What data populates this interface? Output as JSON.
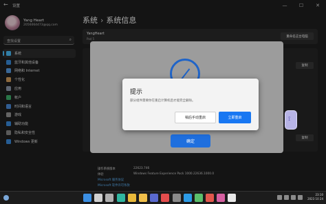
{
  "window": {
    "title": "设置",
    "back_glyph": "←",
    "minimize": "—",
    "maximize": "☐",
    "close": "✕"
  },
  "user": {
    "name": "Yang Heart",
    "email": "2056064473@qq.com"
  },
  "search": {
    "placeholder": "查找设置",
    "icon": "search-icon"
  },
  "sidebar": {
    "items": [
      {
        "label": "系统",
        "icon": "monitor-icon",
        "color": "#4cc2ff",
        "active": true
      },
      {
        "label": "蓝牙和其他设备",
        "icon": "bluetooth-icon",
        "color": "#3a8fe0"
      },
      {
        "label": "网络和 Internet",
        "icon": "wifi-icon",
        "color": "#5aa0e8"
      },
      {
        "label": "个性化",
        "icon": "brush-icon",
        "color": "#d9a25f"
      },
      {
        "label": "应用",
        "icon": "apps-icon",
        "color": "#8f9bb0"
      },
      {
        "label": "帐户",
        "icon": "account-icon",
        "color": "#3fb46f"
      },
      {
        "label": "时间和语言",
        "icon": "globe-clock-icon",
        "color": "#4c8fe0"
      },
      {
        "label": "游戏",
        "icon": "gamepad-icon",
        "color": "#9a9a9a"
      },
      {
        "label": "辅助功能",
        "icon": "accessibility-icon",
        "color": "#3b8fe3"
      },
      {
        "label": "隐私和安全性",
        "icon": "shield-icon",
        "color": "#8a8a8a"
      },
      {
        "label": "Windows 更新",
        "icon": "update-icon",
        "color": "#3b8fe3"
      }
    ]
  },
  "main": {
    "breadcrumb_parent": "系统",
    "breadcrumb_sep": "›",
    "title": "系统信息",
    "device_name": "YangHeart",
    "device_model": "Pad 5",
    "rename_label": "重命名这台电脑",
    "copy_label": "复制",
    "windows_rows": [
      {
        "key": "操作系统版本",
        "value": "22623.746"
      },
      {
        "key": "体验",
        "value": "Windows Feature Experience Pack 1000.22636.1000.0"
      }
    ],
    "links": [
      "Microsoft 服务协议",
      "Microsoft 软件许可条款"
    ]
  },
  "backdrop_dialog": {
    "confirm_label": "确定"
  },
  "restart_dialog": {
    "title": "提示",
    "message": "部分组件需要你在重启计算机后才能完全删除。",
    "later_label": "稍后手动重启",
    "now_label": "立即重启"
  },
  "taskbar": {
    "apps": [
      {
        "icon": "start-icon",
        "color": "#3b8fe3"
      },
      {
        "icon": "search-icon",
        "color": "#d0d0d0"
      },
      {
        "icon": "task-view-icon",
        "color": "#b0b0b0"
      },
      {
        "icon": "edge-icon",
        "color": "#2fb6a0"
      },
      {
        "icon": "chrome-icon",
        "color": "#e9b93a"
      },
      {
        "icon": "explorer-icon",
        "color": "#f2c04a"
      },
      {
        "icon": "photos-icon",
        "color": "#5a6acf"
      },
      {
        "icon": "store-icon",
        "color": "#e44d4d"
      },
      {
        "icon": "settings-icon",
        "color": "#8a8a8a"
      },
      {
        "icon": "qq-icon",
        "color": "#2c9be6"
      },
      {
        "icon": "app-icon",
        "color": "#5bbf6b"
      },
      {
        "icon": "app-icon",
        "color": "#e2574c"
      },
      {
        "icon": "app-icon",
        "color": "#d65fa1"
      },
      {
        "icon": "app-icon",
        "color": "#e8e8e8"
      }
    ],
    "time": "23:10",
    "date": "2023 10 24"
  }
}
